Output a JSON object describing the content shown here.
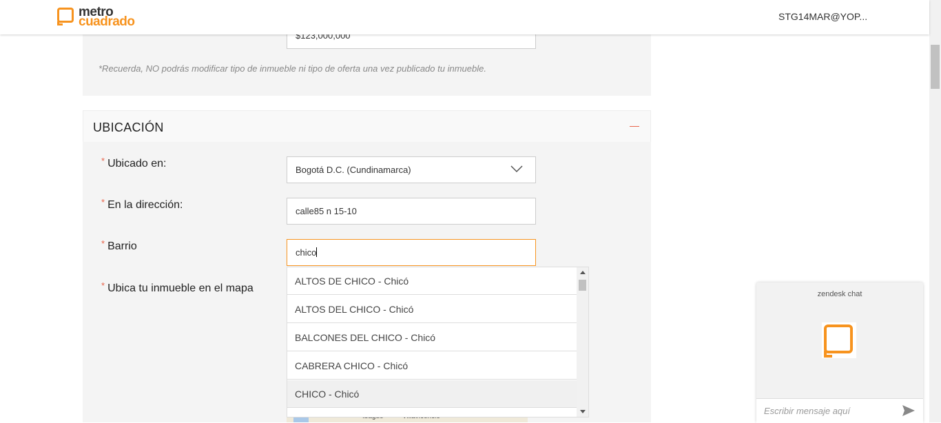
{
  "header": {
    "logo_line1": "metro",
    "logo_line2": "cuadrado",
    "user": "STG14MAR@YOP..."
  },
  "form": {
    "price_value": "$123,000,000",
    "note": "*Recuerda, NO podrás modificar tipo de inmueble ni tipo de oferta una vez publicado tu inmueble.",
    "section_title": "UBICACIÓN",
    "labels": {
      "located_in": "Ubicado en:",
      "address": "En la dirección:",
      "neighborhood": "Barrio",
      "map": "Ubica tu inmueble en el mapa"
    },
    "required_mark": "*",
    "located_in_value": "Bogotá D.C. (Cundinamarca)",
    "address_value": "calle85 n 15-10",
    "neighborhood_value": "chico"
  },
  "dropdown": {
    "items": [
      "ALTOS DE CHICO - Chicó",
      "ALTOS DEL CHICO - Chicó",
      "BALCONES DEL CHICO - Chicó",
      "CABRERA CHICO - Chicó",
      "CHICO - Chicó"
    ],
    "highlighted_index": 4
  },
  "map": {
    "labels": [
      "Ibagué",
      "Villavicencio"
    ]
  },
  "chat": {
    "title": "zendesk chat",
    "placeholder": "Escribir mensaje aquí",
    "icons": [
      "chat-bubble-icon",
      "send-icon"
    ]
  },
  "colors": {
    "accent": "#f7931e",
    "required": "#e8634a",
    "panel_bg": "#f4f4f4"
  }
}
